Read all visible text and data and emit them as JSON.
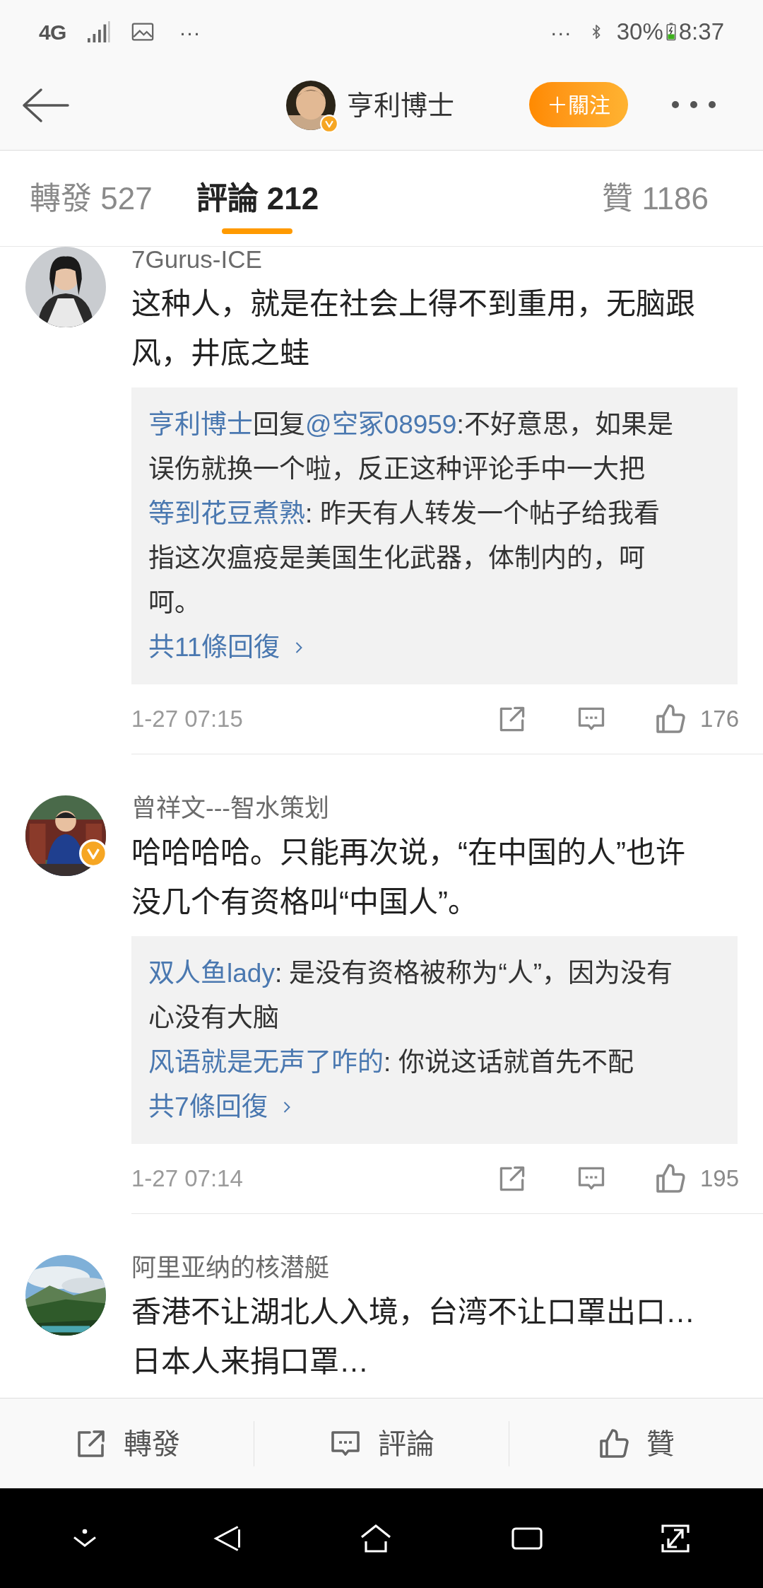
{
  "status_bar": {
    "network": "4G",
    "left_more": "···",
    "right_more": "···",
    "battery": "30%",
    "time": "8:37"
  },
  "header": {
    "name": "亨利博士",
    "verified": true,
    "follow_button": "＋關注"
  },
  "tabs": [
    {
      "label": "轉發",
      "count": "527",
      "selected": false
    },
    {
      "label": "評論",
      "count": "212",
      "selected": true
    },
    {
      "label": "贊",
      "count": "1186",
      "selected": false
    }
  ],
  "comments": [
    {
      "author": "7Gurus-ICE",
      "verified": false,
      "text": "这种人，就是在社会上得不到重用，无脑跟风，井底之蛙",
      "replies": [
        {
          "segments": [
            {
              "text": "亨利博士",
              "kind": "user"
            },
            {
              "text": "回复",
              "kind": "plain"
            },
            {
              "text": "@空冢08959",
              "kind": "user"
            },
            {
              "text": ":不好意思，如果是误伤就换一个啦，反正这种评论手中一大把",
              "kind": "plain"
            }
          ]
        },
        {
          "segments": [
            {
              "text": "等到花豆煮熟",
              "kind": "user"
            },
            {
              "text": ": 昨天有人转发一个帖子给我看指这次瘟疫是美国生化武器，体制内的，呵呵。",
              "kind": "plain"
            }
          ]
        }
      ],
      "more_replies": "共11條回復",
      "time": "1-27 07:15",
      "likes": "176"
    },
    {
      "author": "曾祥文---智水策划",
      "verified": true,
      "text": "哈哈哈哈。只能再次说，“在中国的人”也许没几个有资格叫“中国人”。",
      "replies": [
        {
          "segments": [
            {
              "text": "双人鱼lady",
              "kind": "user"
            },
            {
              "text": ": 是没有资格被称为“人”，因为没有心没有大脑",
              "kind": "plain"
            }
          ]
        },
        {
          "segments": [
            {
              "text": "风语就是无声了咋的",
              "kind": "user"
            },
            {
              "text": ": 你说这话就首先不配",
              "kind": "plain"
            }
          ]
        }
      ],
      "more_replies": "共7條回復",
      "time": "1-27 07:14",
      "likes": "195"
    },
    {
      "author": "阿里亚纳的核潜艇",
      "verified": false,
      "text": "香港不让湖北人入境，台湾不让口罩出口…日本人来捐口罩…"
    }
  ],
  "bottom_bar": [
    {
      "label": "轉發",
      "kind": "repost"
    },
    {
      "label": "評論",
      "kind": "comment"
    },
    {
      "label": "贊",
      "kind": "like"
    }
  ]
}
